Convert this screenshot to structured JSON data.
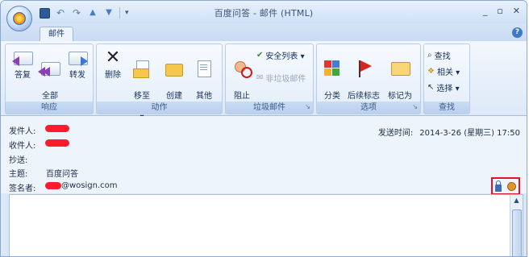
{
  "window": {
    "title": "百度问答 - 邮件 (HTML)",
    "controls": [
      "_",
      "▫",
      "✕"
    ]
  },
  "quick_access": [
    "save-icon",
    "undo-icon",
    "redo-icon",
    "previous-icon",
    "next-icon",
    "customize-icon"
  ],
  "tabs": [
    "邮件"
  ],
  "ribbon": {
    "groups": [
      {
        "title": "响应",
        "buttons": [
          "答复",
          "全部\n答复",
          "转发"
        ]
      },
      {
        "title": "动作",
        "buttons": [
          "删除",
          "移至\n文件夹 ▾",
          "创建\n规则",
          "其他\n动作 ▾"
        ]
      },
      {
        "title": "垃圾邮件",
        "big": "阻止\n发件人",
        "small": [
          "安全列表 ▾",
          "非垃圾邮件"
        ]
      },
      {
        "title": "选项",
        "buttons": [
          "分类\n▾",
          "后续标志\n▾",
          "标记为\n\"未读\""
        ]
      },
      {
        "title": "查找",
        "small": [
          "查找",
          "相关 ▾",
          "选择 ▾"
        ]
      }
    ]
  },
  "header": {
    "from_label": "发件人:",
    "to_label": "收件人:",
    "cc_label": "抄送:",
    "subject_label": "主题:",
    "subject_value": "百度问答",
    "signer_label": "签名者:",
    "signer_value": "@wosign.com",
    "sent_label": "发送时间:",
    "sent_value": "2014-3-26 (星期三) 17:50"
  },
  "colors": {
    "redaction": "#ff1b2e",
    "highlight_box": "#e0142a"
  }
}
